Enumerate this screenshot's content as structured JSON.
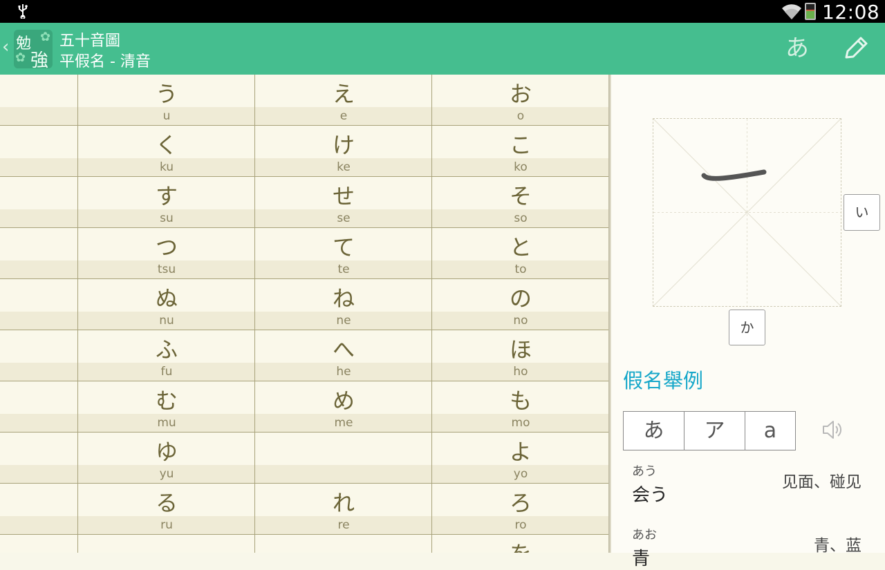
{
  "status_bar": {
    "time": "12:08",
    "icons": [
      "usb-icon",
      "wifi-icon",
      "battery-icon"
    ]
  },
  "action_bar": {
    "title": "五十音圖",
    "subtitle": "平假名 - 清音",
    "kana_toggle": "あ",
    "logo_chars": [
      "勉",
      "強"
    ],
    "colors": {
      "bar": "#45be8f",
      "accent": "#16a7c9"
    }
  },
  "table": {
    "rows": [
      {
        "cells": [
          {
            "k": "",
            "r": ""
          },
          {
            "k": "う",
            "r": "u"
          },
          {
            "k": "え",
            "r": "e"
          },
          {
            "k": "お",
            "r": "o"
          }
        ]
      },
      {
        "cells": [
          {
            "k": "",
            "r": ""
          },
          {
            "k": "く",
            "r": "ku"
          },
          {
            "k": "け",
            "r": "ke"
          },
          {
            "k": "こ",
            "r": "ko"
          }
        ]
      },
      {
        "cells": [
          {
            "k": "",
            "r": ""
          },
          {
            "k": "す",
            "r": "su"
          },
          {
            "k": "せ",
            "r": "se"
          },
          {
            "k": "そ",
            "r": "so"
          }
        ]
      },
      {
        "cells": [
          {
            "k": "",
            "r": ""
          },
          {
            "k": "つ",
            "r": "tsu"
          },
          {
            "k": "て",
            "r": "te"
          },
          {
            "k": "と",
            "r": "to"
          }
        ]
      },
      {
        "cells": [
          {
            "k": "",
            "r": ""
          },
          {
            "k": "ぬ",
            "r": "nu"
          },
          {
            "k": "ね",
            "r": "ne"
          },
          {
            "k": "の",
            "r": "no"
          }
        ]
      },
      {
        "cells": [
          {
            "k": "",
            "r": ""
          },
          {
            "k": "ふ",
            "r": "fu"
          },
          {
            "k": "へ",
            "r": "he"
          },
          {
            "k": "ほ",
            "r": "ho"
          }
        ]
      },
      {
        "cells": [
          {
            "k": "",
            "r": ""
          },
          {
            "k": "む",
            "r": "mu"
          },
          {
            "k": "め",
            "r": "me"
          },
          {
            "k": "も",
            "r": "mo"
          }
        ]
      },
      {
        "cells": [
          {
            "k": "",
            "r": ""
          },
          {
            "k": "ゆ",
            "r": "yu"
          },
          {
            "k": "",
            "r": ""
          },
          {
            "k": "よ",
            "r": "yo"
          }
        ]
      },
      {
        "cells": [
          {
            "k": "",
            "r": ""
          },
          {
            "k": "る",
            "r": "ru"
          },
          {
            "k": "れ",
            "r": "re"
          },
          {
            "k": "ろ",
            "r": "ro"
          }
        ]
      },
      {
        "cells": [
          {
            "k": "",
            "r": ""
          },
          {
            "k": "",
            "r": ""
          },
          {
            "k": "",
            "r": ""
          },
          {
            "k": "を",
            "r": ""
          }
        ]
      }
    ]
  },
  "stroke_panel": {
    "next_button": "い",
    "down_button": "か"
  },
  "examples": {
    "title": "假名舉例",
    "tabs": [
      "あ",
      "ア",
      "a"
    ],
    "items": [
      {
        "reading": "あう",
        "word": "会う",
        "meaning": "见面、碰见"
      },
      {
        "reading": "あお",
        "word": "青",
        "meaning": "青、蓝"
      }
    ]
  }
}
